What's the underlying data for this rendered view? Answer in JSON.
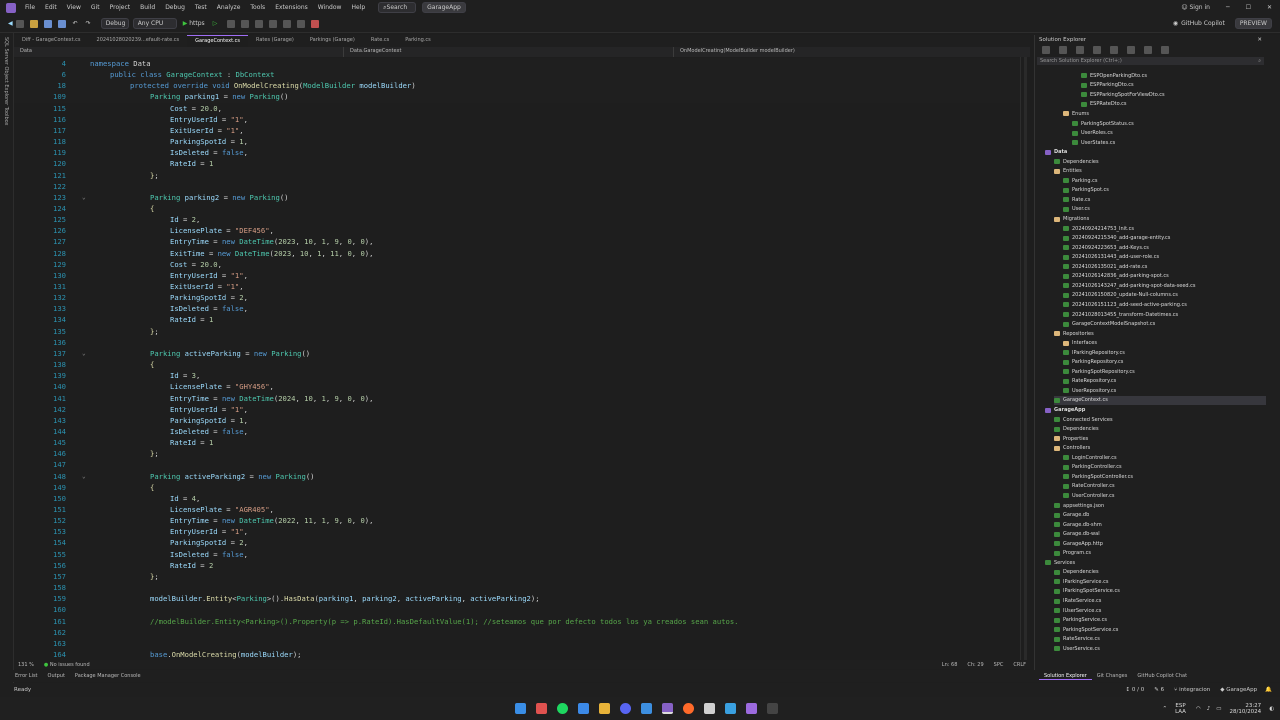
{
  "menu": {
    "items": [
      "File",
      "Edit",
      "View",
      "Git",
      "Project",
      "Build",
      "Debug",
      "Test",
      "Analyze",
      "Tools",
      "Extensions",
      "Window",
      "Help"
    ],
    "search": "Search",
    "app": "GarageApp",
    "signin": "Sign in"
  },
  "toolbar": {
    "config": "Debug",
    "platform": "Any CPU",
    "run": "https",
    "copilot": "GitHub Copilot",
    "preview": "PREVIEW"
  },
  "sidestrip": "SQL Server Object Explorer   Toolbox",
  "tabs": [
    "Diff - GarageContext.cs",
    "20241028020239...efault-rate.cs",
    "GarageContext.cs",
    "Rates (Garage)",
    "Parkings (Garage)",
    "Rate.cs",
    "Parking.cs"
  ],
  "nav": {
    "project": "Data",
    "class": "Data.GarageContext",
    "member": "OnModelCreating(ModelBuilder modelBuilder)"
  },
  "status_line": {
    "zoom": "131 %",
    "issues": "No issues found",
    "ln": "Ln: 68",
    "ch": "Ch: 29",
    "spc": "SPC",
    "crlf": "CRLF"
  },
  "bottom_tabs": [
    "Error List",
    "Output",
    "Package Manager Console"
  ],
  "se_bottom_tabs": [
    "Solution Explorer",
    "Git Changes",
    "GitHub Copilot Chat"
  ],
  "statusbar": {
    "ready": "Ready",
    "counts": "0 / 0",
    "pencil": "6",
    "branch": "integracion",
    "repo": "GarageApp"
  },
  "tray": {
    "lang": "ESP",
    "lang2": "LAA",
    "time": "23:27",
    "date": "28/10/2024"
  },
  "solution_explorer": {
    "title": "Solution Explorer",
    "search": "Search Solution Explorer (Ctrl+;)",
    "items": [
      {
        "d": 4,
        "t": "ESPOpenParkingDto.cs"
      },
      {
        "d": 4,
        "t": "ESPParkingDto.cs"
      },
      {
        "d": 4,
        "t": "ESPParkingSpotForViewDto.cs"
      },
      {
        "d": 4,
        "t": "ESPRateDto.cs"
      },
      {
        "d": 2,
        "t": "Enums",
        "f": 1
      },
      {
        "d": 3,
        "t": "ParkingSpotStatus.cs"
      },
      {
        "d": 3,
        "t": "UserRoles.cs"
      },
      {
        "d": 3,
        "t": "UserStates.cs"
      },
      {
        "d": 0,
        "t": "Data",
        "b": 1
      },
      {
        "d": 1,
        "t": "Dependencies"
      },
      {
        "d": 1,
        "t": "Entities",
        "f": 1
      },
      {
        "d": 2,
        "t": "Parking.cs"
      },
      {
        "d": 2,
        "t": "ParkingSpot.cs"
      },
      {
        "d": 2,
        "t": "Rate.cs"
      },
      {
        "d": 2,
        "t": "User.cs"
      },
      {
        "d": 1,
        "t": "Migrations",
        "f": 1
      },
      {
        "d": 2,
        "t": "20240924214753_Init.cs"
      },
      {
        "d": 2,
        "t": "20240924215340_add-garage-entity.cs"
      },
      {
        "d": 2,
        "t": "20240924223653_add-Keys.cs"
      },
      {
        "d": 2,
        "t": "20241026131443_add-user-role.cs"
      },
      {
        "d": 2,
        "t": "20241026135021_add-rate.cs"
      },
      {
        "d": 2,
        "t": "20241026142836_add-parking-spot.cs"
      },
      {
        "d": 2,
        "t": "20241026143247_add-parking-spot-data-seed.cs"
      },
      {
        "d": 2,
        "t": "20241026150820_update-Null-columns.cs"
      },
      {
        "d": 2,
        "t": "20241026151123_add-seed-active-parking.cs"
      },
      {
        "d": 2,
        "t": "20241028013455_transform-Datetimes.cs"
      },
      {
        "d": 2,
        "t": "GarageContextModelSnapshot.cs"
      },
      {
        "d": 1,
        "t": "Repositories",
        "f": 1
      },
      {
        "d": 2,
        "t": "Interfaces",
        "f": 1
      },
      {
        "d": 2,
        "t": "IParkingRepository.cs"
      },
      {
        "d": 2,
        "t": "ParkingRepository.cs"
      },
      {
        "d": 2,
        "t": "ParkingSpotRepository.cs"
      },
      {
        "d": 2,
        "t": "RateRepository.cs"
      },
      {
        "d": 2,
        "t": "UserRepository.cs"
      },
      {
        "d": 1,
        "t": "GarageContext.cs",
        "sel": 1
      },
      {
        "d": 0,
        "t": "GarageApp",
        "b": 1
      },
      {
        "d": 1,
        "t": "Connected Services"
      },
      {
        "d": 1,
        "t": "Dependencies"
      },
      {
        "d": 1,
        "t": "Properties",
        "f": 1
      },
      {
        "d": 1,
        "t": "Controllers",
        "f": 1
      },
      {
        "d": 2,
        "t": "LoginController.cs"
      },
      {
        "d": 2,
        "t": "ParkingController.cs"
      },
      {
        "d": 2,
        "t": "ParkingSpotController.cs"
      },
      {
        "d": 2,
        "t": "RateController.cs"
      },
      {
        "d": 2,
        "t": "UserController.cs"
      },
      {
        "d": 1,
        "t": "appsettings.json"
      },
      {
        "d": 1,
        "t": "Garage.db"
      },
      {
        "d": 1,
        "t": "Garage.db-shm"
      },
      {
        "d": 1,
        "t": "Garage.db-wal"
      },
      {
        "d": 1,
        "t": "GarageApp.http"
      },
      {
        "d": 1,
        "t": "Program.cs"
      },
      {
        "d": 0,
        "t": "Services"
      },
      {
        "d": 1,
        "t": "Dependencies"
      },
      {
        "d": 1,
        "t": "IParkingService.cs"
      },
      {
        "d": 1,
        "t": "IParkingSpotService.cs"
      },
      {
        "d": 1,
        "t": "IRateService.cs"
      },
      {
        "d": 1,
        "t": "IUserService.cs"
      },
      {
        "d": 1,
        "t": "ParkingService.cs"
      },
      {
        "d": 1,
        "t": "ParkingSpotService.cs"
      },
      {
        "d": 1,
        "t": "RateService.cs"
      },
      {
        "d": 1,
        "t": "UserService.cs"
      }
    ]
  },
  "code": [
    {
      "n": "4",
      "s": 1,
      "h": "<span class=k>namespace</span> <span class=p>Data</span>",
      "i": 0
    },
    {
      "n": "6",
      "s": 1,
      "h": "<span class=k>public class</span> <span class=t>GarageContext</span> : <span class=t>DbContext</span>",
      "i": 1
    },
    {
      "n": "18",
      "s": 1,
      "h": "<span class=k>protected override void</span> <span class=m>OnModelCreating</span>(<span class=t>ModelBuilder</span> <span class=v>modelBuilder</span>)",
      "i": 2
    },
    {
      "n": "109",
      "s": 1,
      "h": "<span class=t>Parking</span> <span class=v>parking1</span> = <span class=k>new</span> <span class=t>Parking</span>()",
      "i": 3
    },
    {
      "n": "115",
      "h": "<span class=v>Cost</span> = <span class=n>20.0</span>,",
      "i": 4
    },
    {
      "n": "116",
      "h": "<span class=v>EntryUserId</span> = <span class=s>\"1\"</span>,",
      "i": 4
    },
    {
      "n": "117",
      "h": "<span class=v>ExitUserId</span> = <span class=s>\"1\"</span>,",
      "i": 4
    },
    {
      "n": "118",
      "h": "<span class=v>ParkingSpotId</span> = <span class=n>1</span>,",
      "i": 4
    },
    {
      "n": "119",
      "h": "<span class=v>IsDeleted</span> = <span class=k>false</span>,",
      "i": 4
    },
    {
      "n": "120",
      "h": "<span class=v>RateId</span> = <span class=n>1</span>",
      "i": 4
    },
    {
      "n": "121",
      "h": "<span class=y>}</span>;",
      "i": 3
    },
    {
      "n": "122",
      "h": "",
      "i": 0
    },
    {
      "n": "123",
      "h": "<span class=t>Parking</span> <span class=v>parking2</span> = <span class=k>new</span> <span class=t>Parking</span>()",
      "i": 3
    },
    {
      "n": "124",
      "h": "<span class=y>{</span>",
      "i": 3
    },
    {
      "n": "125",
      "h": "<span class=v>Id</span> = <span class=n>2</span>,",
      "i": 4
    },
    {
      "n": "126",
      "h": "<span class=v>LicensePlate</span> = <span class=s>\"DEF456\"</span>,",
      "i": 4
    },
    {
      "n": "127",
      "h": "<span class=v>EntryTime</span> = <span class=k>new</span> <span class=t>DateTime</span>(<span class=n>2023</span>, <span class=n>10</span>, <span class=n>1</span>, <span class=n>9</span>, <span class=n>0</span>, <span class=n>0</span>),",
      "i": 4
    },
    {
      "n": "128",
      "h": "<span class=v>ExitTime</span> = <span class=k>new</span> <span class=t>DateTime</span>(<span class=n>2023</span>, <span class=n>10</span>, <span class=n>1</span>, <span class=n>11</span>, <span class=n>0</span>, <span class=n>0</span>),",
      "i": 4
    },
    {
      "n": "129",
      "h": "<span class=v>Cost</span> = <span class=n>20.0</span>,",
      "i": 4
    },
    {
      "n": "130",
      "h": "<span class=v>EntryUserId</span> = <span class=s>\"1\"</span>,",
      "i": 4
    },
    {
      "n": "131",
      "h": "<span class=v>ExitUserId</span> = <span class=s>\"1\"</span>,",
      "i": 4
    },
    {
      "n": "132",
      "h": "<span class=v>ParkingSpotId</span> = <span class=n>2</span>,",
      "i": 4
    },
    {
      "n": "133",
      "h": "<span class=v>IsDeleted</span> = <span class=k>false</span>,",
      "i": 4
    },
    {
      "n": "134",
      "h": "<span class=v>RateId</span> = <span class=n>1</span>",
      "i": 4
    },
    {
      "n": "135",
      "h": "<span class=y>}</span>;",
      "i": 3
    },
    {
      "n": "136",
      "h": "",
      "i": 0
    },
    {
      "n": "137",
      "h": "<span class=t>Parking</span> <span class=v>activeParking</span> = <span class=k>new</span> <span class=t>Parking</span>()",
      "i": 3
    },
    {
      "n": "138",
      "h": "<span class=y>{</span>",
      "i": 3
    },
    {
      "n": "139",
      "h": "<span class=v>Id</span> = <span class=n>3</span>,",
      "i": 4
    },
    {
      "n": "140",
      "h": "<span class=v>LicensePlate</span> = <span class=s>\"GHY456\"</span>,",
      "i": 4
    },
    {
      "n": "141",
      "h": "<span class=v>EntryTime</span> = <span class=k>new</span> <span class=t>DateTime</span>(<span class=n>2024</span>, <span class=n>10</span>, <span class=n>1</span>, <span class=n>9</span>, <span class=n>0</span>, <span class=n>0</span>),",
      "i": 4
    },
    {
      "n": "142",
      "h": "<span class=v>EntryUserId</span> = <span class=s>\"1\"</span>,",
      "i": 4
    },
    {
      "n": "143",
      "h": "<span class=v>ParkingSpotId</span> = <span class=n>1</span>,",
      "i": 4
    },
    {
      "n": "144",
      "h": "<span class=v>IsDeleted</span> = <span class=k>false</span>,",
      "i": 4
    },
    {
      "n": "145",
      "h": "<span class=v>RateId</span> = <span class=n>1</span>",
      "i": 4
    },
    {
      "n": "146",
      "h": "<span class=y>}</span>;",
      "i": 3
    },
    {
      "n": "147",
      "h": "",
      "i": 0
    },
    {
      "n": "148",
      "h": "<span class=t>Parking</span> <span class=v>activeParking2</span> = <span class=k>new</span> <span class=t>Parking</span>()",
      "i": 3
    },
    {
      "n": "149",
      "h": "<span class=y>{</span>",
      "i": 3
    },
    {
      "n": "150",
      "h": "<span class=v>Id</span> = <span class=n>4</span>,",
      "i": 4
    },
    {
      "n": "151",
      "h": "<span class=v>LicensePlate</span> = <span class=s>\"AGR405\"</span>,",
      "i": 4
    },
    {
      "n": "152",
      "h": "<span class=v>EntryTime</span> = <span class=k>new</span> <span class=t>DateTime</span>(<span class=n>2022</span>, <span class=n>11</span>, <span class=n>1</span>, <span class=n>9</span>, <span class=n>0</span>, <span class=n>0</span>),",
      "i": 4
    },
    {
      "n": "153",
      "h": "<span class=v>EntryUserId</span> = <span class=s>\"1\"</span>,",
      "i": 4
    },
    {
      "n": "154",
      "h": "<span class=v>ParkingSpotId</span> = <span class=n>2</span>,",
      "i": 4
    },
    {
      "n": "155",
      "h": "<span class=v>IsDeleted</span> = <span class=k>false</span>,",
      "i": 4
    },
    {
      "n": "156",
      "h": "<span class=v>RateId</span> = <span class=n>2</span>",
      "i": 4
    },
    {
      "n": "157",
      "h": "<span class=y>}</span>;",
      "i": 3
    },
    {
      "n": "158",
      "h": "",
      "i": 0
    },
    {
      "n": "159",
      "h": "<span class=v>modelBuilder</span>.<span class=m>Entity</span>&lt;<span class=t>Parking</span>&gt;().<span class=m>HasData</span>(<span class=v>parking1</span>, <span class=v>parking2</span>, <span class=v>activeParking</span>, <span class=v>activeParking2</span>);",
      "i": 3
    },
    {
      "n": "160",
      "h": "",
      "i": 0
    },
    {
      "n": "161",
      "h": "<span class=c>//modelBuilder.Entity&lt;Parking&gt;().Property(p =&gt; p.RateId).HasDefaultValue(1); //seteamos que por defecto todos los ya creados sean autos.</span>",
      "i": 3
    },
    {
      "n": "162",
      "h": "",
      "i": 0
    },
    {
      "n": "163",
      "h": "",
      "i": 0
    },
    {
      "n": "164",
      "h": "<span class=k>base</span>.<span class=m>OnModelCreating</span>(<span class=v>modelBuilder</span>);",
      "i": 3
    }
  ]
}
